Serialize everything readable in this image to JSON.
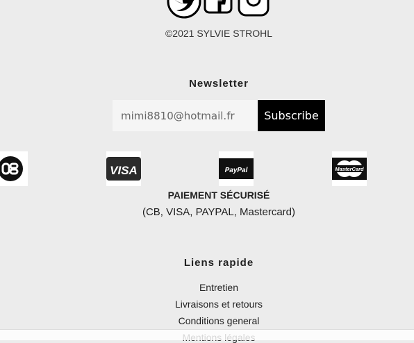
{
  "footer": {
    "copyright": "©2021 SYLVIE STROHL"
  },
  "social": {
    "icons": [
      "twitter-icon",
      "facebook-icon",
      "instagram-icon"
    ]
  },
  "newsletter": {
    "title": "Newsletter",
    "email_value": "mimi8810@hotmail.fr",
    "subscribe_label": "Subscribe"
  },
  "payment": {
    "logos": [
      {
        "name": "cb-logo",
        "text": "CB"
      },
      {
        "name": "visa-logo",
        "text": "VISA"
      },
      {
        "name": "paypal-logo",
        "text": "PayPal"
      },
      {
        "name": "mastercard-logo",
        "text": "MasterCard"
      }
    ],
    "title": "PAIEMENT SÉCURISÉ",
    "subtitle": "(CB, VISA, PAYPAL, Mastercard)"
  },
  "links": {
    "title": "Liens rapide",
    "items": [
      "Entretien",
      "Livraisons et retours",
      "Conditions general",
      "Mentions légales"
    ]
  },
  "colors": {
    "background": "#ececec",
    "button": "#000000",
    "input": "#f5f5f5"
  }
}
